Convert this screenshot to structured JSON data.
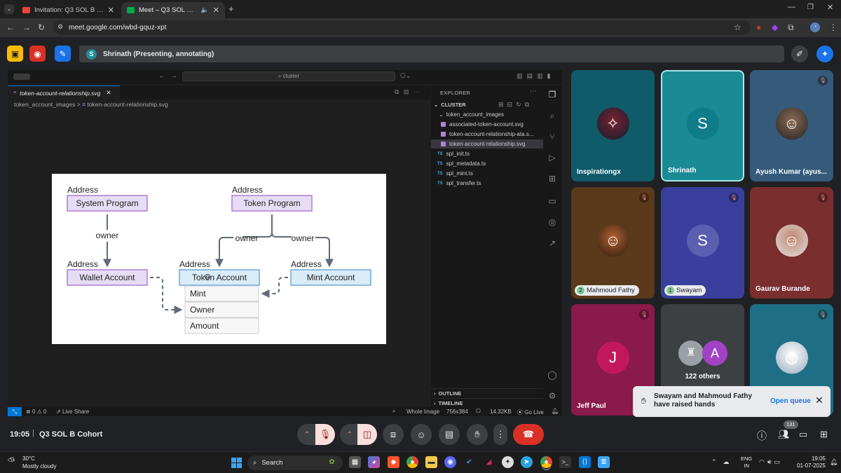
{
  "browser": {
    "tabs": [
      {
        "label": "Invitation: Q3 SOL B Cohort @",
        "active": false
      },
      {
        "label": "Meet – Q3 SOL B Cohort",
        "active": true
      }
    ],
    "url": "meet.google.com/wbd-gquz-xpt"
  },
  "meet": {
    "presenter_initial": "S",
    "presenter_text": "Shrinath (Presenting, annotating)",
    "time": "19:05",
    "meeting_name": "Q3 SOL B Cohort",
    "people_count": "131",
    "participants": [
      {
        "name": "Inspirationgx",
        "initial": "",
        "color": "#0f5b6a",
        "muted": false,
        "hand": ""
      },
      {
        "name": "Shrinath",
        "initial": "S",
        "color": "#1a8a94",
        "muted": false,
        "hand": ""
      },
      {
        "name": "Ayush Kumar (ayus...",
        "initial": "",
        "color": "#355a7a",
        "muted": true,
        "hand": ""
      },
      {
        "name": "Mahmoud Fathy",
        "initial": "",
        "color": "#5a3a1a",
        "muted": true,
        "hand": "2"
      },
      {
        "name": "Swayam",
        "initial": "S",
        "color": "#3a3f9e",
        "muted": true,
        "hand": "1"
      },
      {
        "name": "Gaurav Burande",
        "initial": "",
        "color": "#7a2e2e",
        "muted": true,
        "hand": ""
      },
      {
        "name": "Jeff Paul",
        "initial": "J",
        "color": "#8a1a4a",
        "muted": true,
        "hand": ""
      },
      {
        "name": "122 others",
        "initial": "A",
        "color": "#3c4043",
        "muted": false,
        "hand": ""
      },
      {
        "name": "",
        "initial": "",
        "color": "#1e6f86",
        "muted": true,
        "hand": ""
      }
    ],
    "toast": {
      "message": "Swayam and Mahmoud Fathy have raised hands",
      "action": "Open queue"
    }
  },
  "vscode": {
    "search": "cluster",
    "file_tab": "token-account-relationship.svg",
    "breadcrumb": [
      "token_account_images",
      "token-account-relationship.svg"
    ],
    "explorer_title": "EXPLORER",
    "root": "CLUSTER",
    "folder": "token_account_images",
    "folder_files": [
      "associated-token-account.svg",
      "token-account-relationship-ata.s...",
      "token-account-relationship.svg"
    ],
    "root_files": [
      "spl_init.ts",
      "spl_metadata.ts",
      "spl_mint.ts",
      "spl_transfer.ts"
    ],
    "outline": "OUTLINE",
    "timeline": "TIMELINE",
    "status": {
      "problems": "0",
      "warnings": "0",
      "live_share": "Live Share",
      "view": "Whole Image",
      "dimensions": "756x384",
      "size": "14.32KB",
      "go_live": "Go Live"
    }
  },
  "diagram": {
    "address_label": "Address",
    "system_program": "System Program",
    "token_program": "Token Program",
    "wallet_account": "Wallet Account",
    "token_account": "Token Account",
    "mint_account": "Mint Account",
    "owner_label": "owner",
    "fields": [
      "Mint",
      "Owner",
      "Amount"
    ]
  },
  "taskbar": {
    "weather_temp": "30°C",
    "weather_desc": "Mostly cloudy",
    "search": "Search",
    "lang1": "ENG",
    "lang2": "IN",
    "time": "19:05",
    "date": "01-07-2025"
  }
}
